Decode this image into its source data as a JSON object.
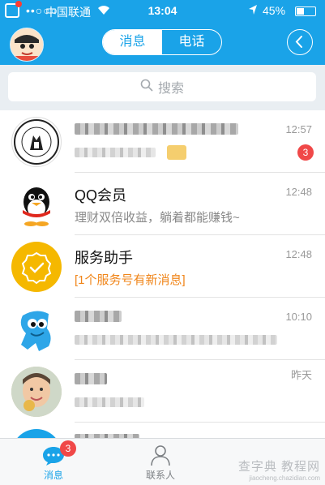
{
  "status_bar": {
    "signal": "••○○○",
    "carrier": "中国联通",
    "time": "13:04",
    "battery": "45%",
    "battery_level": 0.45
  },
  "header": {
    "tabs": [
      {
        "label": "消息",
        "active": true
      },
      {
        "label": "电话",
        "active": false
      }
    ]
  },
  "search": {
    "placeholder": "搜索"
  },
  "conversations": [
    {
      "name": "",
      "message": "",
      "time": "12:57",
      "badge": "3",
      "avatar": "university-seal"
    },
    {
      "name": "QQ会员",
      "message": "理财双倍收益，躺着都能赚钱~",
      "time": "12:48",
      "badge": "",
      "avatar": "qq-penguin"
    },
    {
      "name": "服务助手",
      "message": "[1个服务号有新消息]",
      "time": "12:48",
      "badge": "",
      "avatar": "service-badge"
    },
    {
      "name": "",
      "message": "",
      "time": "10:10",
      "badge": "",
      "avatar": "blue-character"
    },
    {
      "name": "",
      "message": "",
      "time": "昨天",
      "badge": "",
      "avatar": "person-photo"
    }
  ],
  "tabbar": {
    "messages_label": "消息",
    "messages_badge": "3",
    "contacts_label": "联系人"
  },
  "watermark": {
    "line1": "查字典 教程网",
    "line2": "jiaocheng.chazidian.com"
  },
  "colors": {
    "brand": "#1aa3e8",
    "badge": "#f04848",
    "notice": "#f08519"
  }
}
